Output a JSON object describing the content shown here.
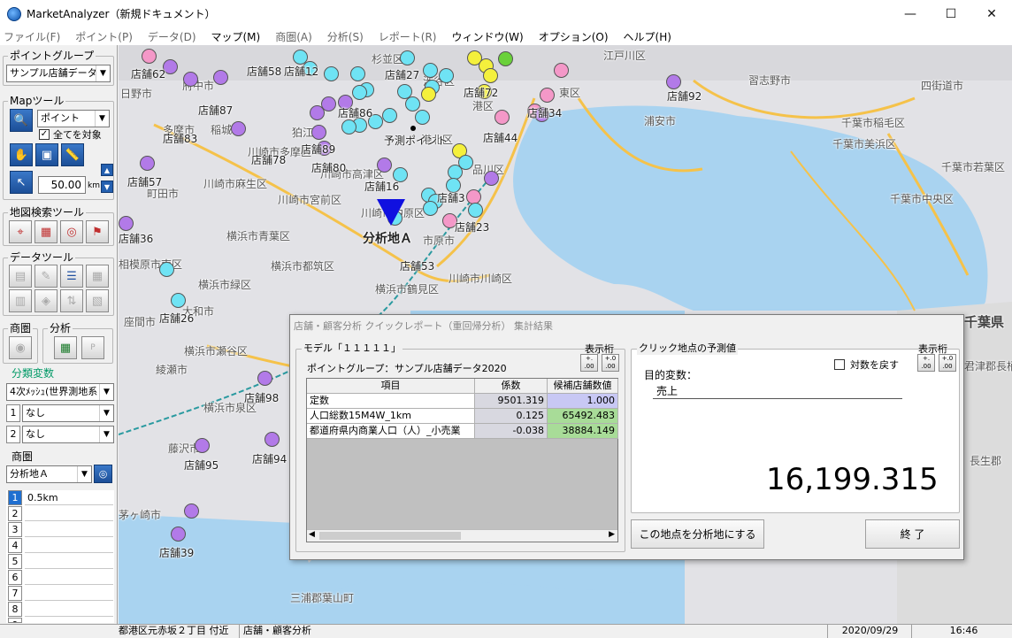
{
  "window": {
    "title": "MarketAnalyzer（新規ドキュメント）",
    "min": "—",
    "max": "☐",
    "close": "✕"
  },
  "menu": [
    "ファイル(F)",
    "ポイント(P)",
    "データ(D)",
    "マップ(M)",
    "商圏(A)",
    "分析(S)",
    "レポート(R)",
    "ウィンドウ(W)",
    "オプション(O)",
    "ヘルプ(H)"
  ],
  "sidebar": {
    "point_group_title": "ポイントグループ",
    "point_group_value": "サンプル店舗データ2",
    "map_tool_title": "Mapツール",
    "map_tool_mode": "ポイント",
    "target_all_label": "全てを対象",
    "distance_value": "50.00",
    "distance_unit": "km",
    "map_search_title": "地図検索ツール",
    "data_tool_title": "データツール",
    "trade_area_tool_title": "商圏",
    "analysis_tool_title": "分析",
    "class_var_title": "分類変数",
    "class_var_mesh": "4次ﾒｯｼｭ(世界測地系",
    "class_var_rows": [
      {
        "num": "1",
        "value": "なし"
      },
      {
        "num": "2",
        "value": "なし"
      }
    ],
    "trade_area_title": "商圏",
    "trade_area_value": "分析地Ａ",
    "trade_rows": [
      {
        "num": "1",
        "value": "0.5km"
      },
      {
        "num": "2",
        "value": ""
      },
      {
        "num": "3",
        "value": ""
      },
      {
        "num": "4",
        "value": ""
      },
      {
        "num": "5",
        "value": ""
      },
      {
        "num": "6",
        "value": ""
      },
      {
        "num": "7",
        "value": ""
      },
      {
        "num": "8",
        "value": ""
      },
      {
        "num": "9",
        "value": ""
      }
    ]
  },
  "map": {
    "places": [
      "江戸川区",
      "杉並区",
      "習志野市",
      "四街道市",
      "日野市",
      "府中市",
      "浦安市",
      "千葉市稲毛区",
      "多摩市",
      "稲城市",
      "狛江市",
      "千葉市美浜区",
      "川崎市多摩区",
      "千葉市若葉区",
      "川崎市麻生区",
      "町田市",
      "川崎市宮前区",
      "千葉市中央区",
      "川崎市中原区",
      "横浜市青葉区",
      "相模原市南区",
      "横浜市都筑区",
      "川崎市川崎区",
      "横浜市緑区",
      "横浜市鶴見区",
      "座間市",
      "大和市",
      "千葉県",
      "横浜市瀬谷区",
      "綾瀬市",
      "君津郡長柄町",
      "横浜市泉区",
      "藤沢市",
      "長生郡",
      "茅ヶ崎市",
      "三浦郡葉山町",
      "渋谷区",
      "港区",
      "東区",
      "品川区",
      "市原市",
      "港北区",
      "川崎市高津区"
    ],
    "stores": [
      "店舗62",
      "店舗58",
      "店舗12",
      "店舗27",
      "店舗92",
      "店舗87",
      "店舗86",
      "店舗72",
      "店舗34",
      "店舗83",
      "店舗89",
      "店舗44",
      "店舗78",
      "店舗80",
      "店舗57",
      "店舗16",
      "店舗3",
      "店舗23",
      "店舗36",
      "店舗53",
      "店舗26",
      "店舗98",
      "店舗94",
      "店舗95",
      "店舗39"
    ],
    "analysis_point_label": "分析地Ａ",
    "forecast_point_label": "予測ポイント"
  },
  "dialog": {
    "title": "店舗・顧客分析 クイックレポート（重回帰分析） 集計結果",
    "model_title": "モデル「１１１１１」",
    "digits_label_left": "表示桁",
    "digits_label_right": "表示桁",
    "point_group_label": "ポイントグループ：",
    "point_group_value": "サンプル店舗データ2020",
    "table_headers": [
      "項目",
      "係数",
      "候補店舗数値"
    ],
    "table_rows": [
      {
        "item": "定数",
        "coef": "9501.319",
        "value": "1.000"
      },
      {
        "item": "人口総数15M4W_1km",
        "coef": "0.125",
        "value": "65492.483"
      },
      {
        "item": "都道府県内商業人口（人）_小売業",
        "coef": "-0.038",
        "value": "38884.149"
      }
    ],
    "forecast_title": "クリック地点の予測値",
    "log_target_label": "対数を戻す",
    "target_var_label": "目的変数：",
    "target_var_value": "売上",
    "predicted_value": "16,199.315",
    "set_point_button": "この地点を分析地にする",
    "close_button": "終 了"
  },
  "status": {
    "address": "都港区元赤坂２丁目 付近",
    "mode": "店舗・顧客分析",
    "date": "2020/09/29",
    "time": "16:46"
  }
}
